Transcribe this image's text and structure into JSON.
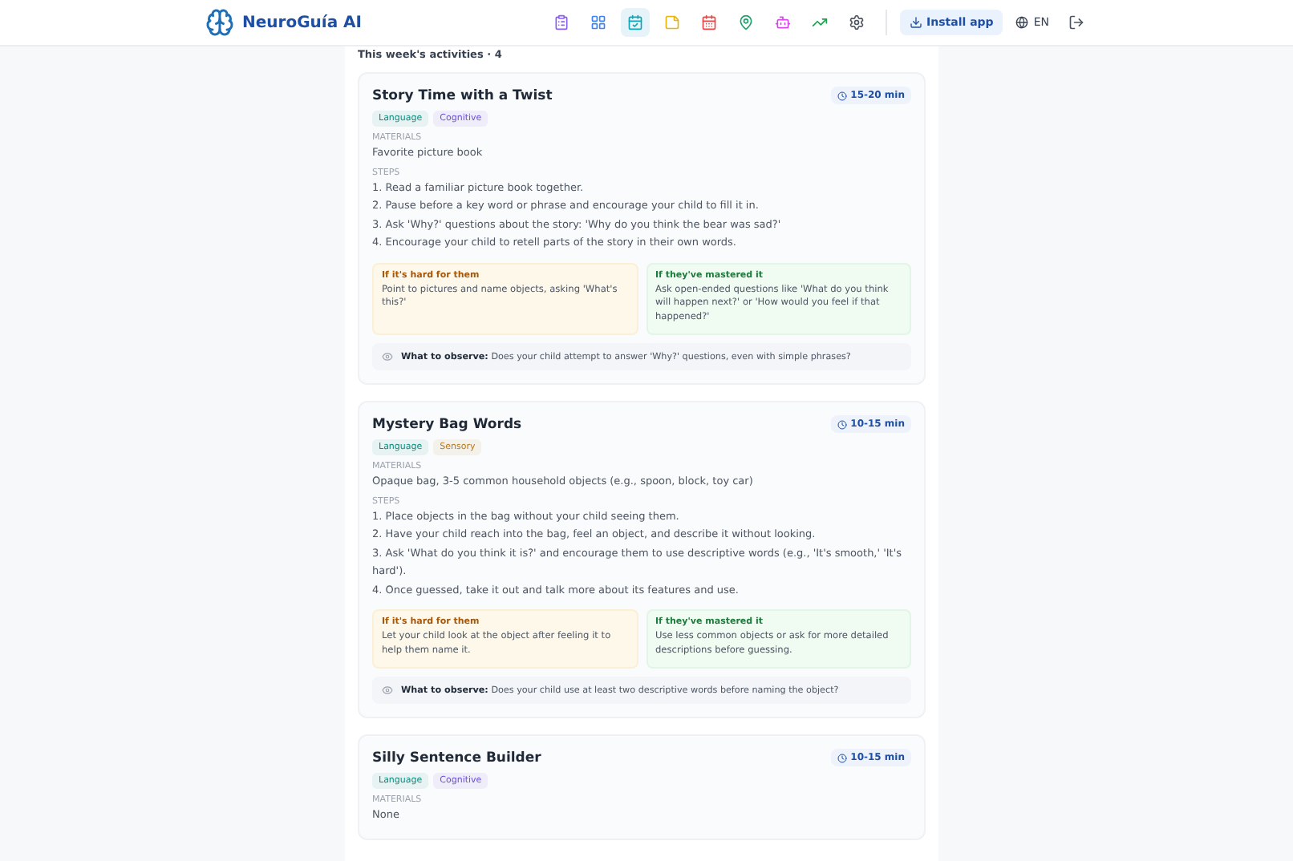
{
  "header": {
    "brand": "NeuroGuía AI",
    "nav": [
      {
        "selected": false
      },
      {
        "selected": false
      },
      {
        "selected": true
      },
      {
        "selected": false
      },
      {
        "selected": false
      },
      {
        "selected": false
      },
      {
        "selected": false
      },
      {
        "selected": false
      },
      {
        "selected": false
      }
    ],
    "install": "Install app",
    "language": "EN"
  },
  "section_title": "This week's activities · 4",
  "activities": [
    {
      "title": "Story Time with a Twist",
      "duration": "15-20 min",
      "tags": [
        {
          "label": "Language",
          "color": "#0f8a7e"
        },
        {
          "label": "Cognitive",
          "color": "#6b4fd8"
        }
      ],
      "materials_label": "MATERIALS",
      "materials": "Favorite picture book",
      "steps_label": "STEPS",
      "steps": [
        "1. Read a familiar picture book together.",
        "2. Pause before a key word or phrase and encourage your child to fill it in.",
        "3. Ask 'Why?' questions about the story: 'Why do you think the bear was sad?'",
        "4. Encourage your child to retell parts of the story in their own words."
      ],
      "hard": {
        "title": "If it's hard for them",
        "text": "Point to pictures and name objects, asking 'What's this?'"
      },
      "mastered": {
        "title": "If they've mastered it",
        "text": "Ask open-ended questions like 'What do you think will happen next?' or 'How would you feel if that happened?'"
      },
      "observe": "**What to observe:** Does your child attempt to answer 'Why?' questions, even with simple phrases?"
    },
    {
      "title": "Mystery Bag Words",
      "duration": "10-15 min",
      "tags": [
        {
          "label": "Language",
          "color": "#0f8a7e"
        },
        {
          "label": "Sensory",
          "color": "#b7791f"
        }
      ],
      "materials_label": "MATERIALS",
      "materials": "Opaque bag, 3-5 common household objects (e.g., spoon, block, toy car)",
      "steps_label": "STEPS",
      "steps": [
        "1. Place objects in the bag without your child seeing them.",
        "2. Have your child reach into the bag, feel an object, and describe it without looking.",
        "3. Ask 'What do you think it is?' and encourage them to use descriptive words (e.g., 'It's smooth,' 'It's hard').",
        "4. Once guessed, take it out and talk more about its features and use."
      ],
      "hard": {
        "title": "If it's hard for them",
        "text": "Let your child look at the object after feeling it to help them name it."
      },
      "mastered": {
        "title": "If they've mastered it",
        "text": "Use less common objects or ask for more detailed descriptions before guessing."
      },
      "observe": "**What to observe:** Does your child use at least two descriptive words before naming the object?"
    },
    {
      "title": "Silly Sentence Builder",
      "duration": "10-15 min",
      "tags": [
        {
          "label": "Language",
          "color": "#0f8a7e"
        },
        {
          "label": "Cognitive",
          "color": "#6b4fd8"
        }
      ],
      "materials_label": "MATERIALS",
      "materials": "None"
    }
  ]
}
